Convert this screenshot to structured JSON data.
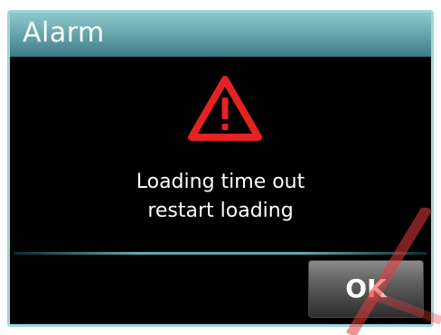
{
  "dialog": {
    "title": "Alarm",
    "icon": "warning-triangle-icon",
    "message_lines": [
      "Loading time out",
      "restart loading"
    ],
    "ok_label": "OK"
  },
  "colors": {
    "accent": "#6aa9b0",
    "warning": "#e52222",
    "background": "#000000"
  }
}
